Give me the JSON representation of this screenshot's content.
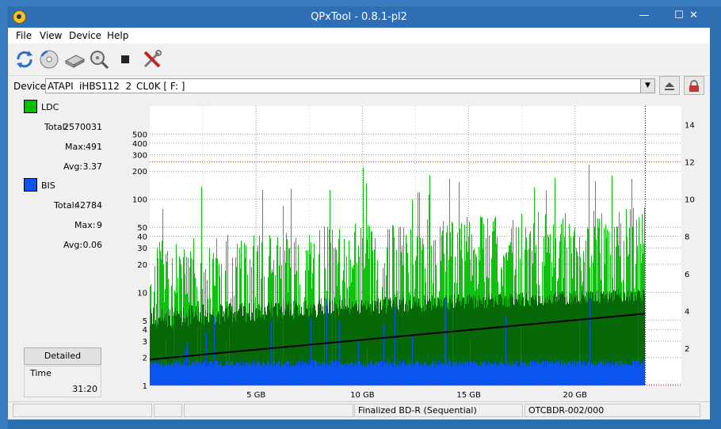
{
  "window": {
    "title": "QPxTool - 0.8.1-pl2"
  },
  "titlebar_buttons": {
    "minimize": "—",
    "maximize": "☐",
    "close": "✕"
  },
  "menu": [
    "File",
    "View",
    "Device",
    "Help"
  ],
  "device": {
    "label": "Device:",
    "vendor": "ATAPI",
    "model": "iHBS112  2",
    "firmware": "CL0K [ F: ]"
  },
  "stats": {
    "ldc": {
      "name": "LDC",
      "color": "#00c000",
      "total_label": "Total:",
      "total": "2570031",
      "max_label": "Max:",
      "max": "491",
      "avg_label": "Avg:",
      "avg": "3.37"
    },
    "bis": {
      "name": "BIS",
      "color": "#0a55f0",
      "total_label": "Total:",
      "total": "42784",
      "max_label": "Max:",
      "max": "9",
      "avg_label": "Avg:",
      "avg": "0.06"
    }
  },
  "buttons": {
    "detailed": "Detailed"
  },
  "time": {
    "label": "Time",
    "value": "31:20"
  },
  "status": {
    "cell1": "",
    "cell2": "",
    "media": "Finalized BD-R (Sequential)",
    "disc_id": "OTCBDR-002/000"
  },
  "chart_data": {
    "type": "bar",
    "x_tick_labels": [
      "5 GB",
      "10 GB",
      "15 GB",
      "20 GB"
    ],
    "x_ticks": [
      5,
      10,
      15,
      20
    ],
    "xlim": [
      0,
      25
    ],
    "data_end_gb": 23.3,
    "y_left_scale": "log",
    "y_left_ticks": [
      1,
      2,
      3,
      4,
      5,
      10,
      20,
      30,
      40,
      50,
      100,
      200,
      300,
      400,
      500
    ],
    "ylim_left": [
      1,
      1000
    ],
    "y_right_ticks": [
      2,
      4,
      6,
      8,
      10,
      12,
      14
    ],
    "ylim_right": [
      0,
      15
    ],
    "series": [
      {
        "name": "LDC",
        "color": "#00c000",
        "max": 491,
        "avg": 3.37
      },
      {
        "name": "BIS",
        "color": "#0a55f0",
        "max": 9,
        "avg": 0.06
      }
    ],
    "speed_line": {
      "color": "#000000",
      "start": 1.9,
      "end": 5.9
    },
    "reference_line_right": 12,
    "grid": true
  }
}
